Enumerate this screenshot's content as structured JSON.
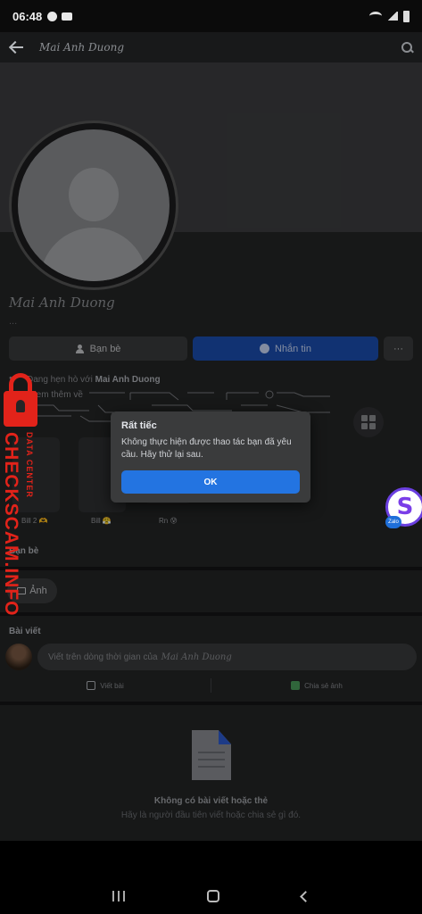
{
  "status_bar": {
    "time": "06:48"
  },
  "app_bar": {
    "title": "Mai Anh Duong"
  },
  "profile": {
    "name": "Mai Anh Duong",
    "subtitle": "...",
    "friends_button": "Bạn bè",
    "message_button": "Nhắn tin",
    "more_button": "···",
    "relationship_prefix": "Đang hẹn hò với",
    "relationship_partner": "Mai Anh Duong",
    "see_more": "Xem thêm về"
  },
  "friends": {
    "section_title": "Bạn bè",
    "items": [
      {
        "name": "Bill 2 🫶"
      },
      {
        "name": "Bill 😤"
      },
      {
        "name": "Rn 😰"
      }
    ]
  },
  "photos": {
    "chip_label": "Ảnh"
  },
  "posts": {
    "section_title": "Bài viết",
    "compose_prefix": "Viết trên dòng thời gian của",
    "compose_name": "Mai Anh Duong",
    "write_post": "Viết bài",
    "share_photo": "Chia sẻ ảnh",
    "empty_title": "Không có bài viết hoặc thẻ",
    "empty_subtitle": "Hãy là người đầu tiên viết hoặc chia sẻ gì đó."
  },
  "dialog": {
    "title": "Rất tiếc",
    "message": "Không thực hiện được thao tác bạn đã yêu cầu. Hãy thử lại sau.",
    "ok_label": "OK"
  },
  "watermark": {
    "main": "CHECKSCAM.INFO",
    "sub": "DATA CENTER"
  },
  "floating": {
    "zalo_label": "Zalo"
  },
  "colors": {
    "accent": "#2374e1",
    "watermark": "#e2231a",
    "background": "#242526"
  }
}
